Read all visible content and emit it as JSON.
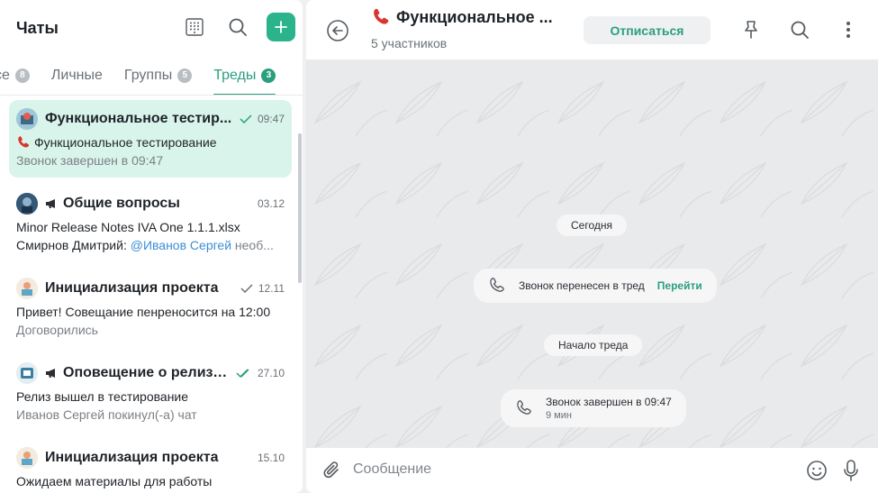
{
  "sidebar": {
    "title": "Чаты",
    "tabs": [
      {
        "label": "се",
        "count": "8",
        "active": false
      },
      {
        "label": "Личные",
        "count": "",
        "active": false
      },
      {
        "label": "Группы",
        "count": "5",
        "active": false
      },
      {
        "label": "Треды",
        "count": "3",
        "active": true
      }
    ],
    "chats": [
      {
        "name": "Функциональное тестир...",
        "time": "09:47",
        "status": "read",
        "line1_icon": "phone-icon",
        "line1": "Функциональное тестирование",
        "line2": "Звонок завершен в 09:47",
        "selected": true
      },
      {
        "name": "Общие вопросы",
        "time": "03.12",
        "status": "",
        "name_icon": "megaphone-icon",
        "line1": "Minor Release Notes IVA One 1.1.1.xlsx",
        "line2_prefix": "Смирнов Дмитрий: ",
        "line2_mention": "@Иванов Сергей",
        "line2_suffix": " необ..."
      },
      {
        "name": "Инициализация проекта",
        "time": "12.11",
        "status": "sent",
        "line1": "Привет! Совещание пенреносится на 12:00",
        "line2": "Договорились"
      },
      {
        "name": "Оповещение о релизах",
        "time": "27.10",
        "status": "read-green",
        "name_icon": "megaphone-icon",
        "line1": "Релиз вышел в тестирование",
        "line2": "Иванов Сергей покинул(-а) чат"
      },
      {
        "name": "Инициализация проекта",
        "time": "15.10",
        "status": "",
        "line1": "Ожидаем материалы для работы",
        "line2": ""
      }
    ]
  },
  "chat": {
    "title": "Функциональное ...",
    "subtitle": "5 участников",
    "unsubscribe_label": "Отписаться",
    "messages": {
      "date_label": "Сегодня",
      "moved_text": "Звонок перенесен в тред",
      "moved_link": "Перейти",
      "thread_start": "Начало треда",
      "call_ended": "Звонок завершен в 09:47",
      "call_duration": "9 мин"
    },
    "composer_placeholder": "Сообщение"
  },
  "colors": {
    "accent": "#2b9e7e",
    "selected_bg": "#d9f4ea",
    "mention": "#3b8ed6",
    "new_button": "#2bb38c"
  }
}
